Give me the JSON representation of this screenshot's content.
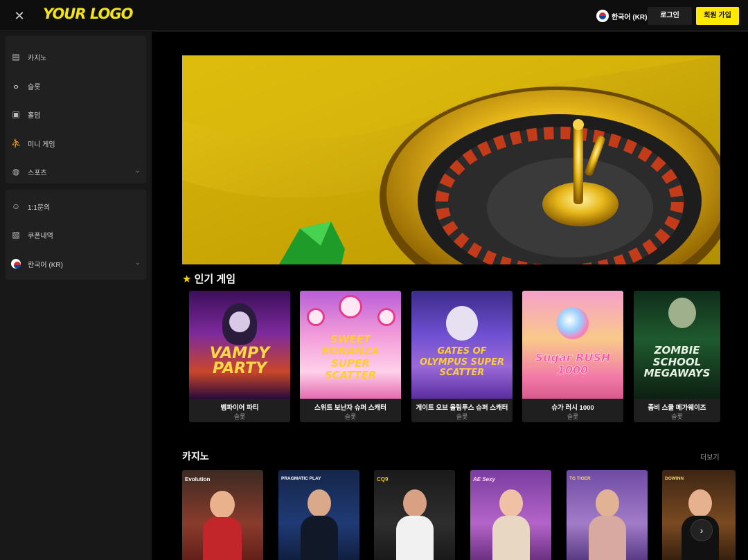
{
  "header": {
    "logo": "YOUR LOGO",
    "language": "한국어 (KR)",
    "login": "로그인",
    "signup": "회원 가입"
  },
  "sidebar": {
    "main_items": [
      {
        "label": "카지노",
        "icon": "cards-icon"
      },
      {
        "label": "슬롯",
        "icon": "cherry-icon"
      },
      {
        "label": "홀덤",
        "icon": "poker-icon"
      },
      {
        "label": "미니 게임",
        "icon": "running-figure-icon"
      },
      {
        "label": "스포츠",
        "icon": "basketball-icon",
        "expandable": true
      }
    ],
    "secondary_items": [
      {
        "label": "1:1문의",
        "icon": "support-chat-icon"
      },
      {
        "label": "쿠폰내역",
        "icon": "coupon-icon"
      },
      {
        "label": "한국어 (KR)",
        "icon": "korea-flag-icon",
        "expandable": true
      }
    ]
  },
  "popular": {
    "title": "인기 게임",
    "games": [
      {
        "name": "뱀파이어 파티",
        "type": "슬롯",
        "art_title": "VAMPY PARTY"
      },
      {
        "name": "스위트 보난자 슈퍼 스캐터",
        "type": "슬롯",
        "art_title": "SWEET BONANZA SUPER SCATTER"
      },
      {
        "name": "게이트 오브 올림푸스 슈퍼 스캐터",
        "type": "슬롯",
        "art_title": "GATES OF OLYMPUS SUPER SCATTER"
      },
      {
        "name": "슈가 러시 1000",
        "type": "슬롯",
        "art_title": "Sugar RUSH 1000"
      },
      {
        "name": "좀비 스쿨 메가웨이즈",
        "type": "슬롯",
        "art_title": "ZOMBIE SCHOOL MEGAWAYS"
      }
    ]
  },
  "casino": {
    "title": "카지노",
    "more": "더보기",
    "providers": [
      "Evolution",
      "PRAGMATIC PLAY",
      "CQ9",
      "AE Sexy",
      "TG TIGER",
      "DOWINN"
    ]
  },
  "colors": {
    "accent": "#ffea00",
    "background": "#000000",
    "sidebar": "#181818",
    "panel": "#202020"
  }
}
